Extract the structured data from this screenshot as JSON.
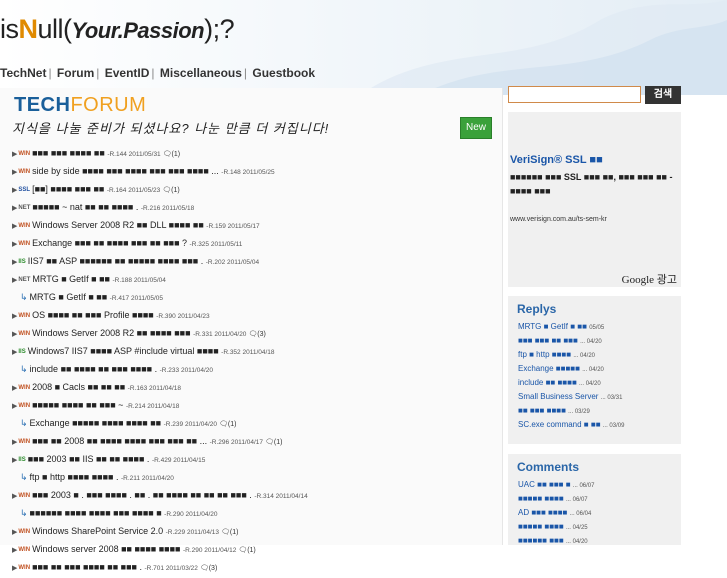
{
  "header": {
    "logo_prefix": "is",
    "logo_n": "N",
    "logo_mid": "ull(",
    "logo_italic": "Your.Passion",
    "logo_suffix": ");?",
    "nav": [
      "TechNet",
      "Forum",
      "EventID",
      "Miscellaneous",
      "Guestbook"
    ]
  },
  "forum": {
    "brand_tech": "TECH",
    "brand_forum": "FORUM",
    "slogan": "지식을 나눌 준비가 되셨나요? 나눈 만큼 더 커집니다!",
    "new_label": "New"
  },
  "posts": [
    {
      "cat": "WIN",
      "reply": false,
      "title": "■■■ ■■■ ■■■■ ■■",
      "meta": "-R.144 2011/05/31",
      "cmt": "(1)"
    },
    {
      "cat": "WIN",
      "reply": false,
      "title": "side by side ■■■■ ■■■ ■■■■ ■■■ ■■■ ■■■■ ...",
      "meta": "-R.148 2011/05/25",
      "cmt": ""
    },
    {
      "cat": "SSL",
      "reply": false,
      "title": "[■■] ■■■■ ■■■ ■■",
      "meta": "-R.164 2011/05/23",
      "cmt": "(1)"
    },
    {
      "cat": "NET",
      "reply": false,
      "title": "■■■■■ ~ nat ■■ ■■ ■■■■ .",
      "meta": "-R.216 2011/05/18",
      "cmt": ""
    },
    {
      "cat": "WIN",
      "reply": false,
      "title": "Windows Server 2008 R2 ■■ DLL ■■■■ ■■",
      "meta": "-R.159 2011/05/17",
      "cmt": ""
    },
    {
      "cat": "WIN",
      "reply": false,
      "title": "Exchange ■■■ ■■ ■■■■ ■■■ ■■ ■■■ ?",
      "meta": "-R.325 2011/05/11",
      "cmt": ""
    },
    {
      "cat": "IIS",
      "reply": false,
      "title": "IIS7 ■■ ASP ■■■■■■ ■■ ■■■■■ ■■■■ ■■■ .",
      "meta": "-R.202 2011/05/04",
      "cmt": ""
    },
    {
      "cat": "NET",
      "reply": false,
      "title": "MRTG ■ GetIf ■ ■■",
      "meta": "-R.188 2011/05/04",
      "cmt": ""
    },
    {
      "cat": "",
      "reply": true,
      "title": "MRTG ■ GetIf ■ ■■",
      "meta": "-R.417 2011/05/05",
      "cmt": ""
    },
    {
      "cat": "WIN",
      "reply": false,
      "title": "OS ■■■■ ■■ ■■■ Profile ■■■■",
      "meta": "-R.390 2011/04/23",
      "cmt": ""
    },
    {
      "cat": "WIN",
      "reply": false,
      "title": "Windows Server 2008 R2 ■■ ■■■■ ■■■",
      "meta": "-R.331 2011/04/20",
      "cmt": "(3)"
    },
    {
      "cat": "IIS",
      "reply": false,
      "title": "Windows7 IIS7 ■■■■ ASP #include virtual ■■■■",
      "meta": "-R.352 2011/04/18",
      "cmt": ""
    },
    {
      "cat": "",
      "reply": true,
      "title": "include ■■ ■■■■ ■■ ■■■ ■■■■ .",
      "meta": "-R.233 2011/04/20",
      "cmt": ""
    },
    {
      "cat": "WIN",
      "reply": false,
      "title": "2008 ■ Cacls ■■ ■■ ■■",
      "meta": "-R.163 2011/04/18",
      "cmt": ""
    },
    {
      "cat": "WIN",
      "reply": false,
      "title": "■■■■■ ■■■■ ■■ ■■■ ~",
      "meta": "-R.214 2011/04/18",
      "cmt": ""
    },
    {
      "cat": "",
      "reply": true,
      "title": "Exchange ■■■■■ ■■■■ ■■■■ ■■",
      "meta": "-R.239 2011/04/20",
      "cmt": "(1)"
    },
    {
      "cat": "WIN",
      "reply": false,
      "title": "■■■ ■■ 2008 ■■ ■■■■ ■■■■ ■■■ ■■■ ■■ ...",
      "meta": "-R.296 2011/04/17",
      "cmt": "(1)"
    },
    {
      "cat": "IIS",
      "reply": false,
      "title": "■■■ 2003 ■■ IIS ■■ ■■ ■■■■ .",
      "meta": "-R.429 2011/04/15",
      "cmt": ""
    },
    {
      "cat": "",
      "reply": true,
      "title": "ftp ■ http ■■■■ ■■■■ .",
      "meta": "-R.211 2011/04/20",
      "cmt": ""
    },
    {
      "cat": "WIN",
      "reply": false,
      "title": "■■■ 2003 ■ . ■■■ ■■■■ . ■■ . ■■ ■■■■ ■■ ■■ ■■ ■■■ .",
      "meta": "-R.314 2011/04/14",
      "cmt": ""
    },
    {
      "cat": "",
      "reply": true,
      "title": "■■■■■■ ■■■■ ■■■■ ■■■ ■■■■ ■",
      "meta": "-R.290 2011/04/20",
      "cmt": ""
    },
    {
      "cat": "WIN",
      "reply": false,
      "title": "Windows SharePoint Service 2.0",
      "meta": "-R.229 2011/04/13",
      "cmt": "(1)"
    },
    {
      "cat": "WIN",
      "reply": false,
      "title": "Windows server 2008 ■■ ■■■■ ■■■■",
      "meta": "-R.290 2011/04/12",
      "cmt": "(1)"
    },
    {
      "cat": "WIN",
      "reply": false,
      "title": "■■■ ■■ ■■■ ■■■■ ■■ ■■■ .",
      "meta": "-R.701 2011/03/22",
      "cmt": "(3)"
    }
  ],
  "sidebar": {
    "search_button": "검색",
    "ad": {
      "title": "VeriSign® SSL ■■",
      "body": "■■■■■■ ■■■ SSL ■■■ ■■, ■■■ ■■■ ■■ - ■■■■ ■■■",
      "url": "www.verisign.com.au/ts-sem-kr",
      "google": "Google 광고"
    },
    "replys_title": "Replys",
    "replys": [
      {
        "text": "MRTG ■ GetIf ■ ■■",
        "date": "05/05"
      },
      {
        "text": "■■■ ■■■ ■■ ■■■",
        "date": "... 04/20"
      },
      {
        "text": "ftp ■ http ■■■■",
        "date": "... 04/20"
      },
      {
        "text": "Exchange ■■■■■",
        "date": "... 04/20"
      },
      {
        "text": "include ■■ ■■■■",
        "date": "... 04/20"
      },
      {
        "text": "Small Business Server",
        "date": "... 03/31"
      },
      {
        "text": "■■ ■■■ ■■■■",
        "date": "... 03/29"
      },
      {
        "text": "SC.exe command ■ ■■",
        "date": "... 03/09"
      }
    ],
    "comments_title": "Comments",
    "comments": [
      {
        "text": "UAC ■■ ■■■ ■",
        "date": "... 06/07"
      },
      {
        "text": "■■■■■ ■■■■",
        "date": "... 06/07"
      },
      {
        "text": "AD ■■■ ■■■■",
        "date": "... 06/04"
      },
      {
        "text": "■■■■■ ■■■■",
        "date": "... 04/25"
      },
      {
        "text": "■■■■■■ ■■■",
        "date": "... 04/20"
      }
    ]
  }
}
